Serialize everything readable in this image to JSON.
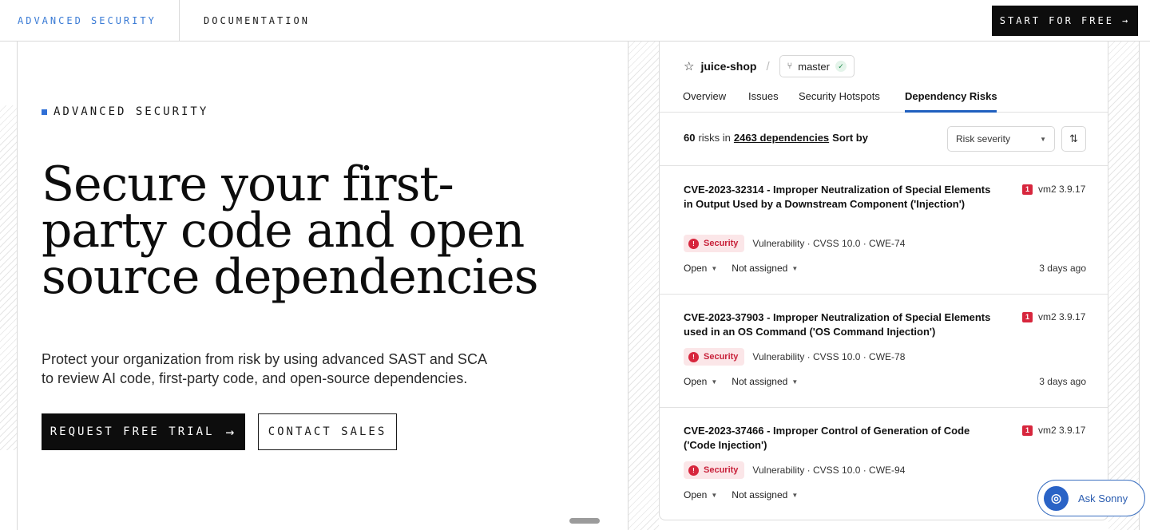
{
  "nav": {
    "advanced_security": "ADVANCED SECURITY",
    "documentation": "DOCUMENTATION",
    "start_label": "START FOR FREE",
    "start_arrow": "→"
  },
  "hero": {
    "eyebrow": "ADVANCED SECURITY",
    "headline": "Secure your first-party code and open source dependencies",
    "subtext": "Protect your organization from risk by using advanced SAST and SCA to review AI code, first-party code, and open-source dependencies.",
    "trial_label": "REQUEST FREE TRIAL",
    "trial_arrow": "→",
    "contact_label": "CONTACT SALES"
  },
  "card": {
    "repo": "juice-shop",
    "repo_separator": "/",
    "branch": "master",
    "tabs": [
      {
        "label": "Overview",
        "active": false
      },
      {
        "label": "Issues",
        "active": false
      },
      {
        "label": "Security Hotspots",
        "active": false
      },
      {
        "label": "Dependency Risks",
        "active": true
      }
    ],
    "summary": {
      "count": "60",
      "risks_in": "risks in",
      "deps": "2463 dependencies",
      "sort_by": "Sort by"
    },
    "sort_value": "Risk severity",
    "issues": [
      {
        "title": "CVE-2023-32314 - Improper Neutralization of Special Elements in Output Used by a Downstream Component ('Injection')",
        "severity": "1",
        "package": "vm2 3.9.17",
        "tag": "Security",
        "meta": "Vulnerability · CVSS 10.0 · CWE-74",
        "status": "Open",
        "assignee": "Not assigned",
        "time": "3 days ago"
      },
      {
        "title": "CVE-2023-37903 - Improper Neutralization of Special Elements used in an OS Command ('OS Command Injection')",
        "severity": "1",
        "package": "vm2 3.9.17",
        "tag": "Security",
        "meta": "Vulnerability · CVSS 10.0 · CWE-78",
        "status": "Open",
        "assignee": "Not assigned",
        "time": "3 days ago"
      },
      {
        "title": "CVE-2023-37466 - Improper Control of Generation of Code ('Code Injection')",
        "severity": "1",
        "package": "vm2 3.9.17",
        "tag": "Security",
        "meta": "Vulnerability · CVSS 10.0 · CWE-94",
        "status": "Open",
        "assignee": "Not assigned",
        "time": ""
      }
    ]
  },
  "assistant": {
    "label": "Ask Sonny"
  },
  "colors": {
    "accent_blue": "#2f6fd6",
    "severity_red": "#d7263d",
    "ink": "#0d0d0d"
  }
}
